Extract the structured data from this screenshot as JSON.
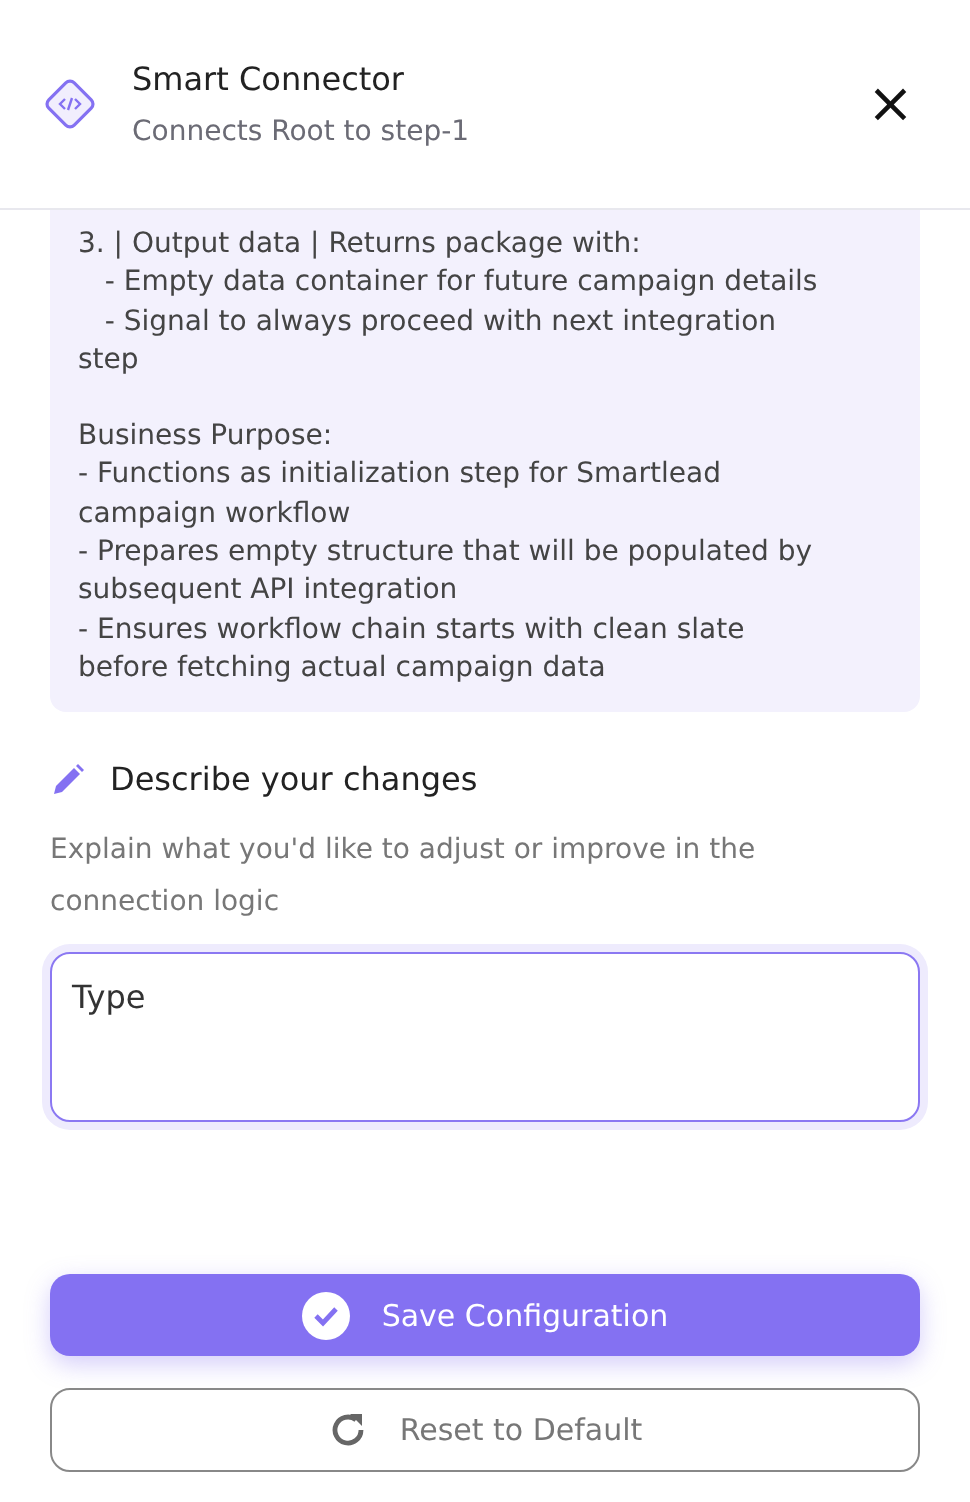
{
  "header": {
    "title": "Smart Connector",
    "subtitle": "Connects Root to step-1",
    "close": "×"
  },
  "description": {
    "blocks": [
      [
        "3. | Output data | Returns package with:",
        "   - Empty data container for future campaign details",
        "   - Signal to always proceed with next integration",
        "step"
      ],
      [
        "Business Purpose:",
        "- Functions as initialization step for Smartlead",
        "campaign workflow",
        "- Prepares empty structure that will be populated by",
        "subsequent API integration",
        "- Ensures workflow chain starts with clean slate",
        "before fetching actual campaign data"
      ]
    ]
  },
  "changes": {
    "heading": "Describe your changes",
    "hint": "Explain what you'd like to adjust or improve in the connection logic",
    "value": "Type",
    "focused": true
  },
  "buttons": [
    {
      "label": "Save Configuration",
      "kind": "primary"
    },
    {
      "label": "Reset to Default",
      "kind": "outline"
    }
  ]
}
